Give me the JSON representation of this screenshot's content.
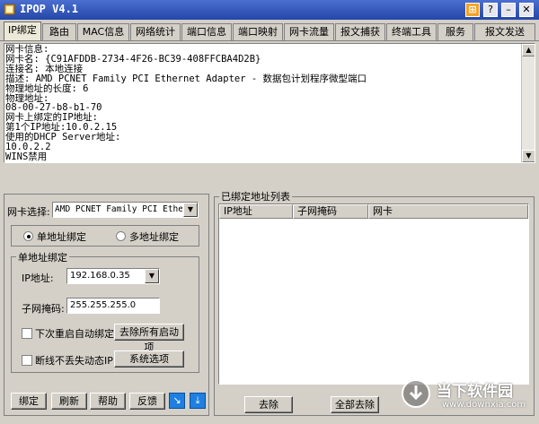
{
  "window": {
    "title": "IPOP V4.1"
  },
  "tabs": [
    "IP绑定",
    "路由",
    "MAC信息",
    "网络统计",
    "端口信息",
    "端口映射",
    "网卡流量",
    "报文捕获",
    "终端工具",
    "服务",
    "报文发送"
  ],
  "info_lines": [
    "网卡信息:",
    "网卡名: {C91AFDDB-2734-4F26-BC39-408FFCBA4D2B}",
    "连接名: 本地连接",
    "描述: AMD PCNET Family PCI Ethernet Adapter - 数据包计划程序微型端口",
    "物理地址的长度: 6",
    "物理地址:",
    "08-00-27-b8-b1-70",
    "网卡上绑定的IP地址:",
    "第1个IP地址:10.0.2.15",
    "使用的DHCP Server地址:",
    "10.0.2.2",
    "WINS禁用"
  ],
  "left": {
    "nic_label": "网卡选择:",
    "nic_value": "AMD PCNET Family PCI Etherne",
    "radio_single": "单地址绑定",
    "radio_multi": "多地址绑定",
    "group_title": "单地址绑定",
    "ip_label": "IP地址:",
    "ip_value": "192.168.0.35",
    "mask_label": "子网掩码:",
    "mask_value": "255.255.255.0",
    "check_autobind": "下次重启自动绑定",
    "btn_clear_all": "去除所有启动项",
    "check_keep": "断线不丢失动态IP",
    "btn_sys": "系统选项"
  },
  "bottom_buttons": [
    "绑定",
    "刷新",
    "帮助",
    "反馈"
  ],
  "right": {
    "group_title": "已绑定地址列表",
    "columns": [
      "IP地址",
      "子网掩码",
      "网卡"
    ],
    "btn_remove": "去除",
    "btn_remove_all": "全部去除"
  },
  "watermark": {
    "title": "当下软件园",
    "url": "www.downxia.com"
  },
  "colors": {
    "titlebar": "#2447a8",
    "face": "#d4d0c8"
  }
}
